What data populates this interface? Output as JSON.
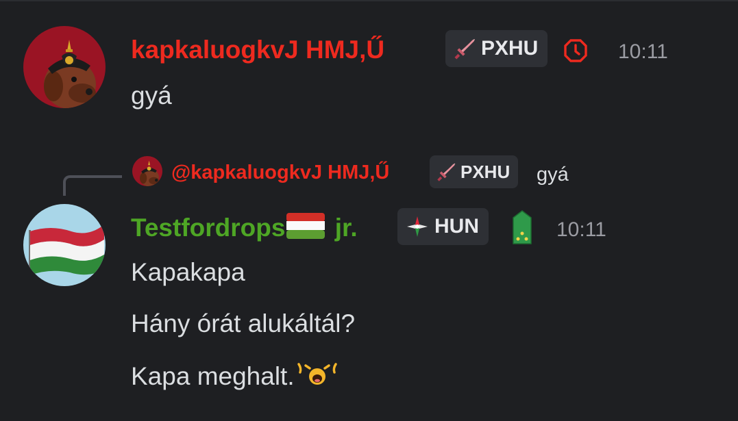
{
  "colors": {
    "background": "#1e1f22",
    "username_red": "#ee2a1f",
    "username_green": "#4ea625",
    "text": "#dbdee1",
    "muted": "#9b9ca3"
  },
  "messages": [
    {
      "author": "kapkaluogkvJ HMJ,Ű",
      "tag": "PXHU",
      "tag_icon": "sword-icon",
      "status_icon": "clock-icon",
      "time": "10:11",
      "lines": [
        "gyá"
      ]
    },
    {
      "reply": {
        "mention": "@kapkaluogkvJ HMJ,Ű",
        "tag": "PXHU",
        "snippet": "gyá"
      },
      "author_name": "Testfordrops",
      "author_flag": "hungary-flag-icon",
      "author_suffix": "jr.",
      "tag": "HUN",
      "tag_icon": "compass-rose-icon",
      "rank_icon": "rank-insignia-icon",
      "time": "10:11",
      "lines": [
        "Kapakapa",
        "Hány órát alukáltál?",
        "Kapa meghalt."
      ],
      "emoji": "crying-face-icon"
    }
  ]
}
